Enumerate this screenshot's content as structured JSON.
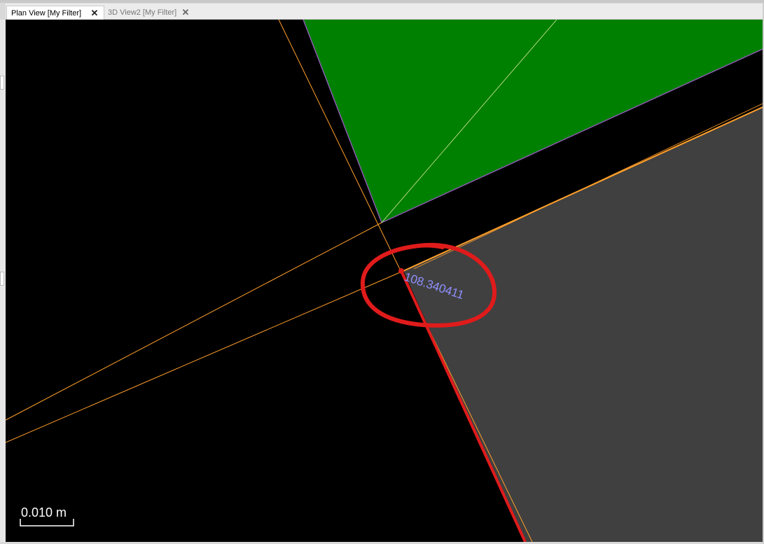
{
  "tabs": [
    {
      "label": "Plan View [My Filter]",
      "close_icon": "close-icon",
      "active": true
    },
    {
      "label": "3D View2 [My Filter]",
      "close_icon": "close-icon",
      "active": false
    }
  ],
  "viewport": {
    "dimension_text": "108.340411",
    "scale_bar_label": "0.010 m",
    "colors": {
      "background": "#000000",
      "green_region": "#008000",
      "gray_region": "#404040",
      "guide_line": "#ff9f2a",
      "selected_edge": "#e01b1b",
      "annotation_circle": "#e01b1b",
      "dimension_text": "#8f8fff",
      "purple_edge": "#8a5bb0"
    }
  }
}
